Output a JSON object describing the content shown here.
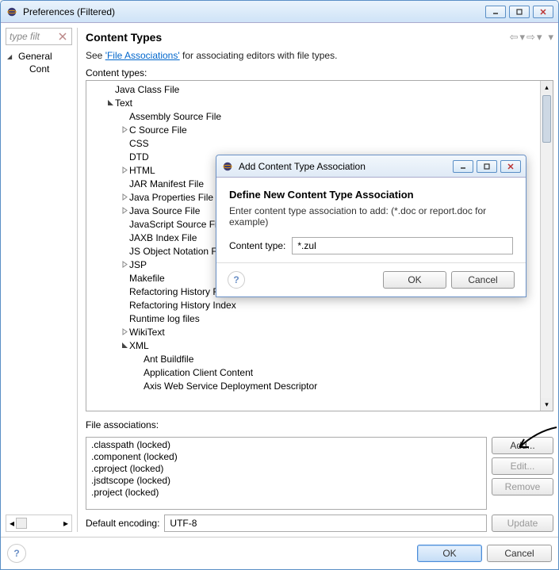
{
  "window": {
    "title": "Preferences (Filtered)",
    "filter_placeholder": "type filt"
  },
  "nav": {
    "items": [
      {
        "label": "General",
        "expanded": true,
        "depth": 0
      },
      {
        "label": "Cont",
        "depth": 1,
        "selected": true
      }
    ]
  },
  "content": {
    "heading": "Content Types",
    "desc_prefix": "See ",
    "desc_link": "'File Associations'",
    "desc_suffix": " for associating editors with file types.",
    "tree_label": "Content types:",
    "tree": [
      {
        "label": "Java Class File",
        "depth": 1
      },
      {
        "label": "Text",
        "depth": 1,
        "twisty": "expanded"
      },
      {
        "label": "Assembly Source File",
        "depth": 2
      },
      {
        "label": "C Source File",
        "depth": 2,
        "twisty": "collapsed"
      },
      {
        "label": "CSS",
        "depth": 2
      },
      {
        "label": "DTD",
        "depth": 2
      },
      {
        "label": "HTML",
        "depth": 2,
        "twisty": "collapsed"
      },
      {
        "label": "JAR Manifest File",
        "depth": 2
      },
      {
        "label": "Java Properties File",
        "depth": 2,
        "twisty": "collapsed"
      },
      {
        "label": "Java Source File",
        "depth": 2,
        "twisty": "collapsed"
      },
      {
        "label": "JavaScript Source File",
        "depth": 2
      },
      {
        "label": "JAXB Index File",
        "depth": 2
      },
      {
        "label": "JS Object Notation File",
        "depth": 2
      },
      {
        "label": "JSP",
        "depth": 2,
        "twisty": "collapsed"
      },
      {
        "label": "Makefile",
        "depth": 2
      },
      {
        "label": "Refactoring History File",
        "depth": 2
      },
      {
        "label": "Refactoring History Index",
        "depth": 2
      },
      {
        "label": "Runtime log files",
        "depth": 2
      },
      {
        "label": "WikiText",
        "depth": 2,
        "twisty": "collapsed"
      },
      {
        "label": "XML",
        "depth": 2,
        "twisty": "expanded"
      },
      {
        "label": "Ant Buildfile",
        "depth": 3
      },
      {
        "label": "Application Client Content",
        "depth": 3
      },
      {
        "label": "Axis Web Service Deployment Descriptor",
        "depth": 3
      }
    ],
    "assoc_label": "File associations:",
    "assoc_items": [
      ".classpath (locked)",
      ".component (locked)",
      ".cproject (locked)",
      ".jsdtscope (locked)",
      ".project (locked)"
    ],
    "buttons": {
      "add": "Add...",
      "edit": "Edit...",
      "remove": "Remove",
      "update": "Update"
    },
    "encoding_label": "Default encoding:",
    "encoding_value": "UTF-8"
  },
  "footer": {
    "ok": "OK",
    "cancel": "Cancel"
  },
  "modal": {
    "title": "Add Content Type Association",
    "heading": "Define New Content Type Association",
    "desc": "Enter content type association to add: (*.doc or report.doc for example)",
    "field_label": "Content type:",
    "field_value": "*.zul",
    "ok": "OK",
    "cancel": "Cancel"
  }
}
